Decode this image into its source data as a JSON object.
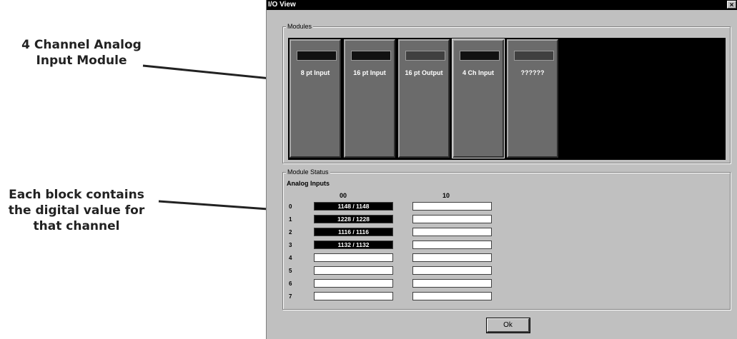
{
  "callouts": {
    "module_callout": "4 Channel Analog Input Module",
    "block_callout": "Each block contains the digital value for that channel"
  },
  "window": {
    "title": "I/O View",
    "close_glyph": "×"
  },
  "modules_group": {
    "label": "Modules",
    "modules": [
      {
        "label": "8 pt Input"
      },
      {
        "label": "16 pt Input"
      },
      {
        "label": "16 pt Output"
      },
      {
        "label": "4 Ch Input",
        "selected": true
      },
      {
        "label": "??????"
      }
    ]
  },
  "status_group": {
    "label": "Module Status",
    "section_title": "Analog Inputs",
    "columns": [
      "00",
      "10"
    ],
    "rows": [
      {
        "label": "0",
        "col00": "1148 / 1148",
        "col10": ""
      },
      {
        "label": "1",
        "col00": "1228 / 1228",
        "col10": ""
      },
      {
        "label": "2",
        "col00": "1116 / 1116",
        "col10": ""
      },
      {
        "label": "3",
        "col00": "1132 / 1132",
        "col10": ""
      },
      {
        "label": "4",
        "col00": "",
        "col10": ""
      },
      {
        "label": "5",
        "col00": "",
        "col10": ""
      },
      {
        "label": "6",
        "col00": "",
        "col10": ""
      },
      {
        "label": "7",
        "col00": "",
        "col10": ""
      }
    ]
  },
  "ok_label": "Ok",
  "colors": {
    "window_bg": "#c0c0c0",
    "rack_bg": "#000000",
    "module_bg": "#6b6b6b"
  }
}
